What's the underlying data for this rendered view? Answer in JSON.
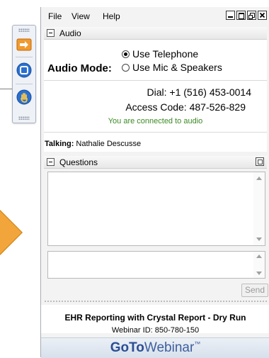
{
  "menu": {
    "file": "File",
    "view": "View",
    "help": "Help"
  },
  "window_controls": [
    "minimize-icon",
    "restore-icon",
    "popout-icon",
    "close-icon"
  ],
  "audio": {
    "header": "Audio",
    "mode_label": "Audio Mode:",
    "options": [
      {
        "label": "Use Telephone",
        "selected": true
      },
      {
        "label": "Use Mic & Speakers",
        "selected": false
      }
    ],
    "dial_label": "Dial:",
    "dial_value": "+1 (516) 453-0014",
    "access_label": "Access Code:",
    "access_value": "487-526-829",
    "status": "You are connected to audio",
    "talking_label": "Talking:",
    "talking_name": "Nathalie Descusse"
  },
  "questions": {
    "header": "Questions",
    "send_label": "Send"
  },
  "webinar": {
    "title": "EHR Reporting with Crystal Report - Dry Run",
    "id_label": "Webinar ID: 850-780-150"
  },
  "brand": {
    "go": "Go",
    "to": "To",
    "webinar": "Webinar",
    "tm": "™"
  },
  "toolbar": {
    "icons": [
      "arrow-icon",
      "screen-icon",
      "raise-hand-icon"
    ]
  },
  "colors": {
    "status_green": "#3a8a23",
    "brand_blue": "#2b4e93",
    "accent_orange": "#f2a53a"
  }
}
